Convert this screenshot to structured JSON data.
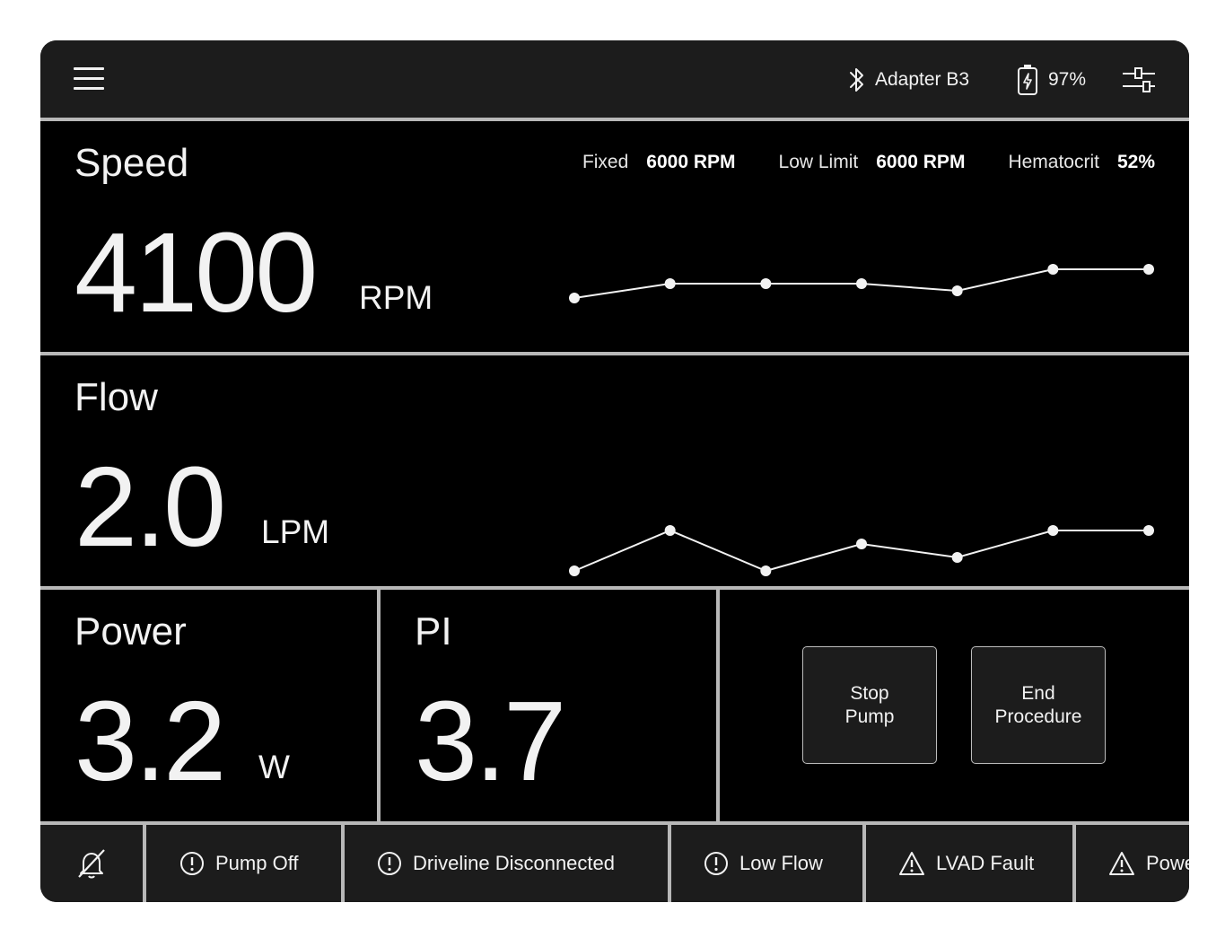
{
  "topbar": {
    "menu_icon": "hamburger-menu-icon",
    "bluetooth_icon": "bluetooth-icon",
    "adapter_label": "Adapter B3",
    "battery_icon": "battery-charging-icon",
    "battery_percent": "97%",
    "settings_icon": "sliders-settings-icon"
  },
  "speed": {
    "title": "Speed",
    "value": "4100",
    "unit": "RPM",
    "meta": [
      {
        "label": "Fixed",
        "value": "6000 RPM"
      },
      {
        "label": "Low Limit",
        "value": "6000 RPM"
      },
      {
        "label": "Hematocrit",
        "value": "52%"
      }
    ],
    "trend": [
      1,
      3,
      3,
      3,
      2,
      5,
      5
    ],
    "trend_min": 0,
    "trend_max": 5
  },
  "flow": {
    "title": "Flow",
    "value": "2.0",
    "unit": "LPM",
    "trend": [
      1,
      4,
      1,
      3,
      2,
      4,
      4
    ],
    "trend_min": 0,
    "trend_max": 4
  },
  "power": {
    "title": "Power",
    "value": "3.2",
    "unit": "W"
  },
  "pi": {
    "title": "PI",
    "value": "3.7"
  },
  "actions": {
    "stop_pump": "Stop\nPump",
    "end_procedure": "End\nProcedure"
  },
  "alarms": {
    "silence_icon": "alarm-silenced-bell-icon",
    "items": [
      {
        "icon": "exclamation-circle-icon",
        "label": "Pump Off"
      },
      {
        "icon": "exclamation-circle-icon",
        "label": "Driveline Disconnected"
      },
      {
        "icon": "exclamation-circle-icon",
        "label": "Low Flow"
      },
      {
        "icon": "warning-triangle-icon",
        "label": "LVAD Fault"
      },
      {
        "icon": "warning-triangle-icon",
        "label": "Power"
      }
    ]
  },
  "colors": {
    "background": "#000000",
    "bar": "#1c1c1c",
    "divider": "#b8b8b8",
    "text": "#f2f2f2"
  }
}
